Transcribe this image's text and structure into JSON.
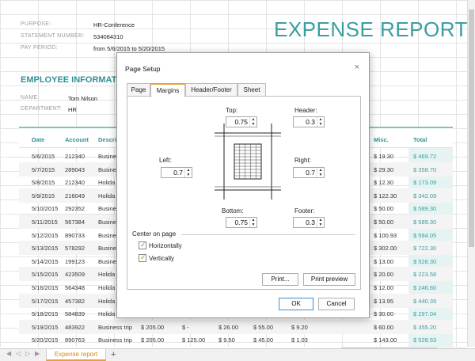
{
  "report": {
    "title": "EXPENSE REPORT",
    "fields": [
      {
        "label": "PURPOSE:",
        "value": "HR-Conference"
      },
      {
        "label": "STATEMENT NUMBER:",
        "value": "534084310"
      },
      {
        "label": "PAY PERIOD:",
        "value": "from 5/6/2015 to 5/20/2015"
      }
    ],
    "employee_heading": "EMPLOYEE INFORMATION",
    "employee": [
      {
        "label": "NAME:",
        "value": "Tom Nilson"
      },
      {
        "label": "DEPARTMENT:",
        "value": "HR"
      }
    ]
  },
  "table": {
    "headers": [
      "Date",
      "Account",
      "Descri",
      "Misc.",
      "Total"
    ],
    "rows": [
      [
        "5/6/2015",
        "212340",
        "Busine",
        "",
        "",
        "",
        "",
        "",
        "$ 19.30",
        "$ 469.72"
      ],
      [
        "5/7/2015",
        "289043",
        "Busine",
        "",
        "",
        "",
        "",
        "",
        "$ 29.30",
        "$ 358.70"
      ],
      [
        "5/8/2015",
        "212340",
        "Holida",
        "",
        "",
        "",
        "",
        "",
        "$ 12.30",
        "$ 173.09"
      ],
      [
        "5/9/2015",
        "216049",
        "Holida",
        "",
        "",
        "",
        "",
        "",
        "$ 122.30",
        "$ 342.09"
      ],
      [
        "5/10/2015",
        "292352",
        "Busine",
        "",
        "",
        "",
        "",
        "",
        "$ 50.00",
        "$ 589.30"
      ],
      [
        "5/11/2015",
        "567384",
        "Busine",
        "",
        "",
        "",
        "",
        "",
        "$ 50.00",
        "$ 589.30"
      ],
      [
        "5/12/2015",
        "890733",
        "Busine",
        "",
        "",
        "",
        "",
        "",
        "$ 100.93",
        "$ 594.05"
      ],
      [
        "5/13/2015",
        "578292",
        "Busine",
        "",
        "",
        "",
        "",
        "",
        "$ 302.00",
        "$ 722.30"
      ],
      [
        "5/14/2015",
        "199123",
        "Busine",
        "",
        "",
        "",
        "",
        "",
        "$ 13.00",
        "$ 528.30"
      ],
      [
        "5/15/2015",
        "423509",
        "Holida",
        "",
        "",
        "",
        "",
        "",
        "$ 20.00",
        "$ 223.58"
      ],
      [
        "5/16/2015",
        "564348",
        "Holida",
        "",
        "",
        "",
        "",
        "",
        "$ 12.00",
        "$ 246.60"
      ],
      [
        "5/17/2015",
        "457382",
        "Holida",
        "",
        "",
        "",
        "",
        "",
        "$ 13.95",
        "$ 440.39"
      ],
      [
        "5/18/2015",
        "584839",
        "Holida",
        "",
        "",
        "",
        "",
        "",
        "$ 30.00",
        "$ 297.04"
      ],
      [
        "5/19/2015",
        "483922",
        "Business trip",
        "$ 205.00",
        "$ -",
        "$ 26.00",
        "$ 55.00",
        "$ 9.20",
        "$ 60.00",
        "$ 355.20"
      ],
      [
        "5/20/2015",
        "890763",
        "Business trip",
        "$ 205.00",
        "$ 125.00",
        "$ 9.50",
        "$ 45.00",
        "$ 1.03",
        "$ 143.00",
        "$ 528.53"
      ]
    ]
  },
  "sheet_tabs": {
    "active": "Expense report",
    "add": "+"
  },
  "dialog": {
    "title": "Page Setup",
    "close": "×",
    "tabs": [
      "Page",
      "Margins",
      "Header/Footer",
      "Sheet"
    ],
    "active_tab": "Margins",
    "margins": {
      "top_label": "Top:",
      "top": "0.75",
      "header_label": "Header:",
      "header": "0.3",
      "left_label": "Left:",
      "left": "0.7",
      "right_label": "Right:",
      "right": "0.7",
      "bottom_label": "Bottom:",
      "bottom": "0.75",
      "footer_label": "Footer:",
      "footer": "0.3"
    },
    "center_group": "Center on page",
    "horizontally": {
      "label": "Horizontally",
      "checked": true
    },
    "vertically": {
      "label": "Vertically",
      "checked": true
    },
    "print_label": "Print...",
    "preview_label": "Print preview",
    "ok_label": "OK",
    "cancel_label": "Cancel"
  },
  "colors": {
    "accent": "#3a9ea0",
    "tab_accent": "#e7a03a"
  }
}
